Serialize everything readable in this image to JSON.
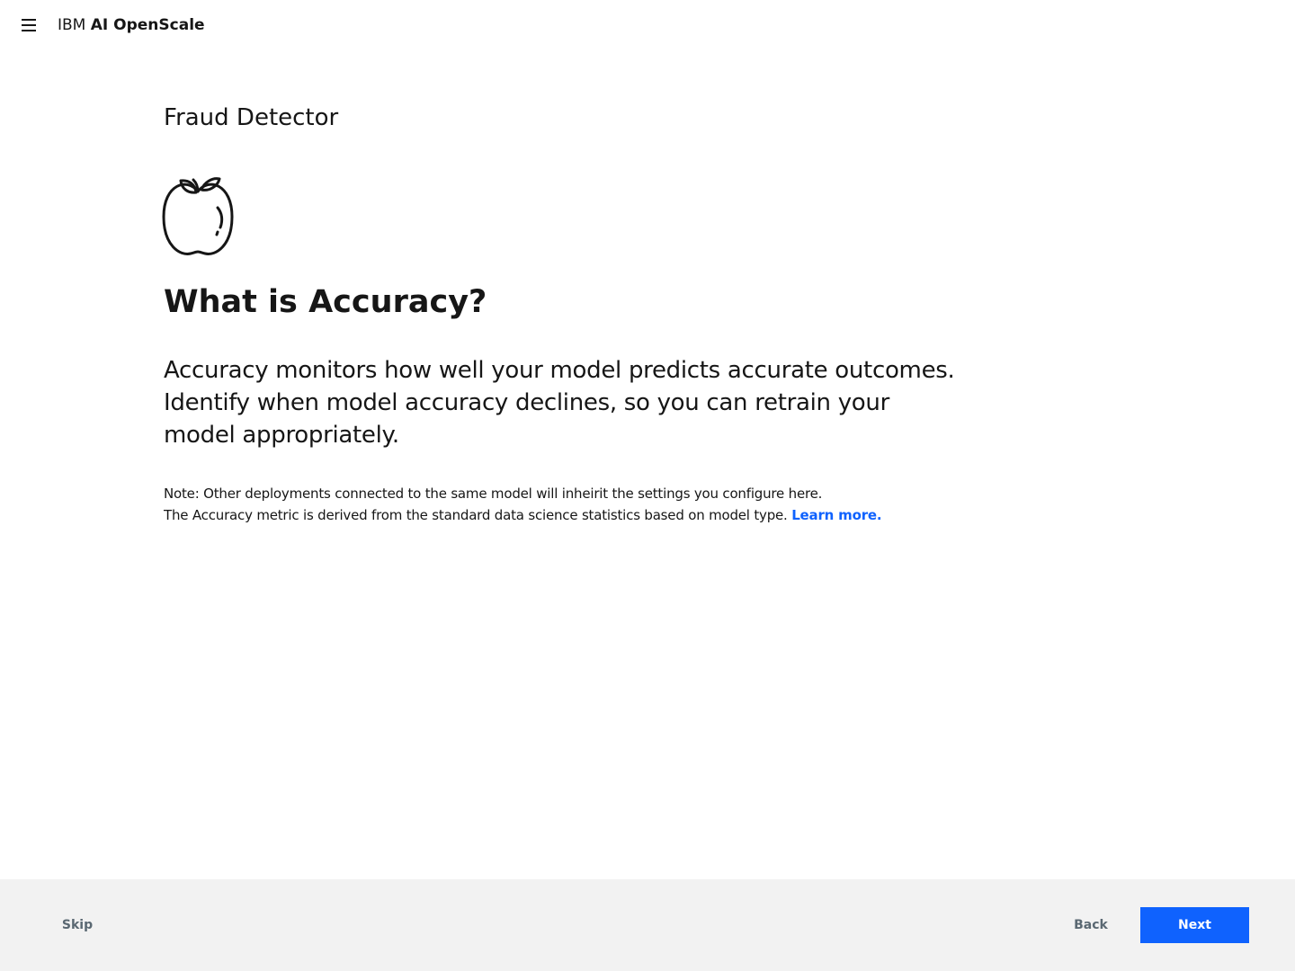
{
  "header": {
    "brand_prefix": "IBM",
    "brand_product": "AI OpenScale",
    "menu_icon": "hamburger-menu-icon"
  },
  "main": {
    "subtitle": "Fraud Detector",
    "hero_icon": "apple-icon",
    "heading": "What is Accuracy?",
    "lead": "Accuracy monitors how well your model predicts accurate outcomes. Identify when model accuracy declines, so you can retrain your model appropriately.",
    "note_line1": "Note: Other deployments connected to the same model will inheirit the settings you configure here.",
    "note_line2": "The Accuracy metric is derived from the standard data science statistics based on model type.",
    "learn_more": "Learn more."
  },
  "footer": {
    "skip_label": "Skip",
    "back_label": "Back",
    "next_label": "Next"
  },
  "colors": {
    "primary": "#0f62fe",
    "footer_bg": "#f2f2f2",
    "secondary_text": "#5a6872",
    "text": "#161616"
  }
}
